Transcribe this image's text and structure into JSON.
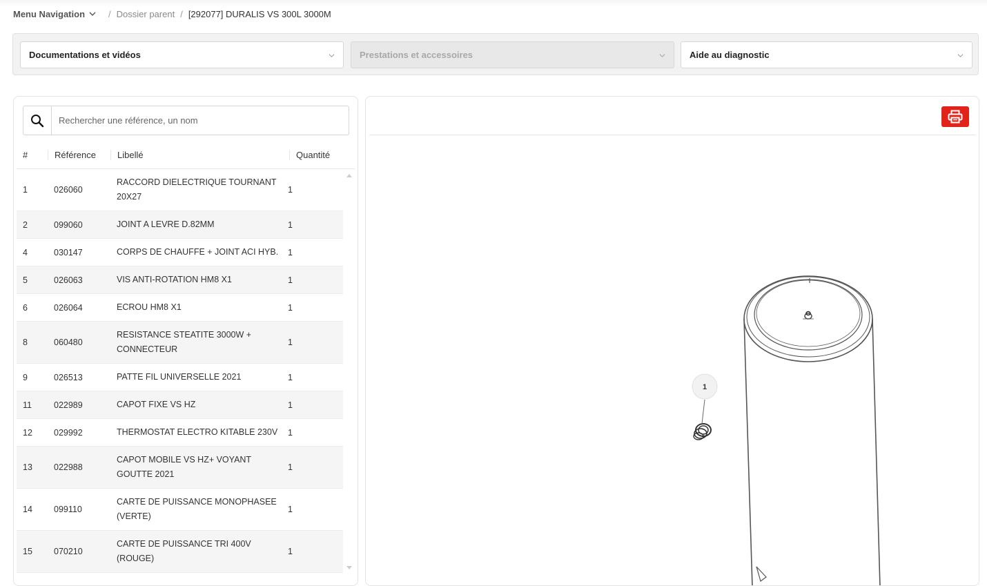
{
  "breadcrumb": {
    "menu_label": "Menu Navigation",
    "separator": "/",
    "parent": "Dossier parent",
    "current": "[292077] DURALIS VS 300L 3000M"
  },
  "filters": [
    {
      "label": "Documentations et vidéos",
      "disabled": false
    },
    {
      "label": "Prestations et accessoires",
      "disabled": true
    },
    {
      "label": "Aide au diagnostic",
      "disabled": false
    }
  ],
  "search": {
    "placeholder": "Rechercher une référence, un nom",
    "icon": "search-icon"
  },
  "table": {
    "headers": {
      "num": "#",
      "ref": "Référence",
      "lib": "Libellé",
      "qty": "Quantité"
    },
    "rows": [
      {
        "num": "1",
        "ref": "026060",
        "lib": "RACCORD DIELECTRIQUE TOURNANT 20X27",
        "qty": "1"
      },
      {
        "num": "2",
        "ref": "099060",
        "lib": "JOINT A LEVRE D.82MM",
        "qty": "1"
      },
      {
        "num": "4",
        "ref": "030147",
        "lib": "CORPS DE CHAUFFE + JOINT ACI HYB.",
        "qty": "1"
      },
      {
        "num": "5",
        "ref": "026063",
        "lib": "VIS ANTI-ROTATION HM8 X1",
        "qty": "1"
      },
      {
        "num": "6",
        "ref": "026064",
        "lib": "ECROU HM8 X1",
        "qty": "1"
      },
      {
        "num": "8",
        "ref": "060480",
        "lib": "RESISTANCE STEATITE 3000W + CONNECTEUR",
        "qty": "1"
      },
      {
        "num": "9",
        "ref": "026513",
        "lib": "PATTE FIL UNIVERSELLE 2021",
        "qty": "1"
      },
      {
        "num": "11",
        "ref": "022989",
        "lib": "CAPOT FIXE VS HZ",
        "qty": "1"
      },
      {
        "num": "12",
        "ref": "029992",
        "lib": "THERMOSTAT ELECTRO KITABLE 230V",
        "qty": "1"
      },
      {
        "num": "13",
        "ref": "022988",
        "lib": "CAPOT MOBILE VS HZ+ VOYANT GOUTTE 2021",
        "qty": "1"
      },
      {
        "num": "14",
        "ref": "099110",
        "lib": "CARTE DE PUISSANCE MONOPHASEE (VERTE)",
        "qty": "1"
      },
      {
        "num": "15",
        "ref": "070210",
        "lib": "CARTE DE PUISSANCE TRI 400V (ROUGE)",
        "qty": "1"
      }
    ]
  },
  "viewer": {
    "print_icon": "printer-icon",
    "print_color": "#e2231a",
    "callouts": [
      {
        "label": "1"
      }
    ]
  }
}
